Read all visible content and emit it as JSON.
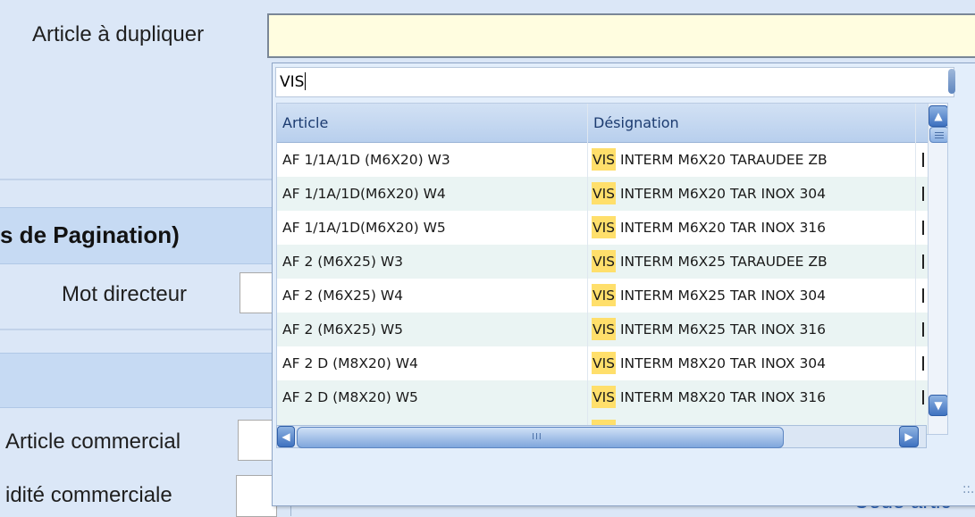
{
  "form": {
    "article_a_dupliquer_label": "Article à dupliquer",
    "section_title": "s de Pagination)",
    "mot_directeur_label": "Mot directeur",
    "article_commercial_label": "Article commercial",
    "validite_commerciale_label": "idité commerciale",
    "code_article_label": "Code artic"
  },
  "dropdown": {
    "search_value": "VIS",
    "columns": [
      "Article",
      "Désignation"
    ],
    "highlight_term": "VIS",
    "rows": [
      {
        "article": "AF 1/1A/1D (M6X20) W3",
        "designation": "INTERM M6X20 TARAUDEE ZB"
      },
      {
        "article": "AF 1/1A/1D(M6X20)  W4",
        "designation": "INTERM M6X20 TAR INOX 304"
      },
      {
        "article": "AF 1/1A/1D(M6X20) W5",
        "designation": "INTERM M6X20 TAR INOX 316"
      },
      {
        "article": "AF 2 (M6X25) W3",
        "designation": "INTERM M6X25 TARAUDEE ZB"
      },
      {
        "article": "AF 2 (M6X25) W4",
        "designation": "INTERM M6X25 TAR INOX 304"
      },
      {
        "article": "AF 2 (M6X25) W5",
        "designation": "INTERM M6X25 TAR INOX 316"
      },
      {
        "article": "AF 2 D (M8X20) W4",
        "designation": "INTERM M8X20 TAR INOX 304"
      },
      {
        "article": "AF 2 D (M8X20) W5",
        "designation": "INTERM M8X20 TAR INOX 316"
      }
    ],
    "scroll_up_icon": "chevron-up-icon",
    "scroll_down_icon": "chevron-down-icon",
    "scroll_left_icon": "chevron-left-icon",
    "scroll_right_icon": "chevron-right-icon",
    "hscroll_grip": "III"
  },
  "colors": {
    "highlight": "#ffdf6b",
    "field_background": "#fffde0",
    "alt_row": "#eaf4f3",
    "page_background": "#dbe7f7"
  }
}
